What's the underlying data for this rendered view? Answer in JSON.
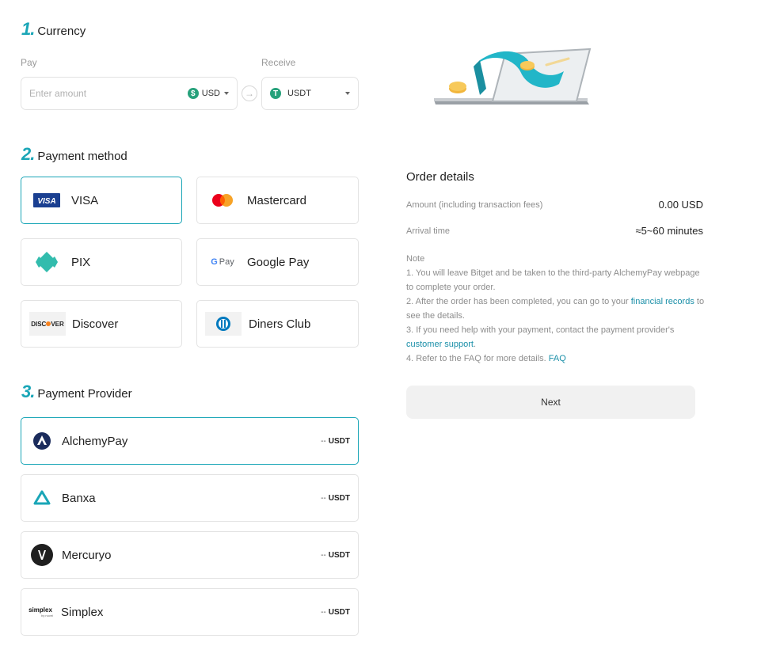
{
  "currency": {
    "step_number": "1.",
    "title": "Currency",
    "pay_label": "Pay",
    "receive_label": "Receive",
    "amount_placeholder": "Enter amount",
    "pay_currency": "USD",
    "pay_currency_icon": "$",
    "receive_currency": "USDT",
    "receive_currency_icon": "T"
  },
  "payment_method": {
    "step_number": "2.",
    "title": "Payment method",
    "options": [
      {
        "label": "VISA",
        "icon": "visa-icon",
        "selected": true
      },
      {
        "label": "Mastercard",
        "icon": "mastercard-icon",
        "selected": false
      },
      {
        "label": "PIX",
        "icon": "pix-icon",
        "selected": false
      },
      {
        "label": "Google Pay",
        "icon": "google-pay-icon",
        "selected": false
      },
      {
        "label": "Discover",
        "icon": "discover-icon",
        "selected": false
      },
      {
        "label": "Diners Club",
        "icon": "diners-club-icon",
        "selected": false
      }
    ],
    "logo_text": {
      "visa": "VISA",
      "gpay_g": "G",
      "gpay_pay": "Pay",
      "discover": "DISC",
      "discover_tail": "VER"
    }
  },
  "payment_provider": {
    "step_number": "3.",
    "title": "Payment Provider",
    "providers": [
      {
        "name": "AlchemyPay",
        "rate_prefix": "--",
        "rate_currency": "USDT",
        "icon": "alchemypay-icon",
        "selected": true
      },
      {
        "name": "Banxa",
        "rate_prefix": "--",
        "rate_currency": "USDT",
        "icon": "banxa-icon",
        "selected": false
      },
      {
        "name": "Mercuryo",
        "rate_prefix": "--",
        "rate_currency": "USDT",
        "icon": "mercuryo-icon",
        "selected": false
      },
      {
        "name": "Simplex",
        "rate_prefix": "--",
        "rate_currency": "USDT",
        "icon": "simplex-icon",
        "selected": false
      }
    ],
    "simplex_logo_text": "simplex",
    "simplex_logo_sub": "by nuvei"
  },
  "order_details": {
    "title": "Order details",
    "amount_label": "Amount (including transaction fees)",
    "amount_value": "0.00 USD",
    "arrival_label": "Arrival time",
    "arrival_value": "≈5~60 minutes",
    "note_title": "Note",
    "note_1": "1. You will leave Bitget and be taken to the third-party AlchemyPay webpage to complete your order.",
    "note_2_pre": "2. After the order has been completed, you can go to your ",
    "note_2_link": "financial records",
    "note_2_post": " to see the details.",
    "note_3_pre": "3. If you need help with your payment, contact the payment provider's ",
    "note_3_link": "customer support",
    "note_3_post": ".",
    "note_4_pre": "4. Refer to the FAQ for more details. ",
    "note_4_link": "FAQ",
    "next_label": "Next"
  },
  "colors": {
    "accent": "#1aa6b7",
    "tether": "#26a17b",
    "link": "#1a8fa8",
    "visa_blue": "#1a3f91",
    "mastercard_red": "#eb001b",
    "mastercard_orange": "#f79e1b",
    "pix_teal": "#32bcad"
  }
}
